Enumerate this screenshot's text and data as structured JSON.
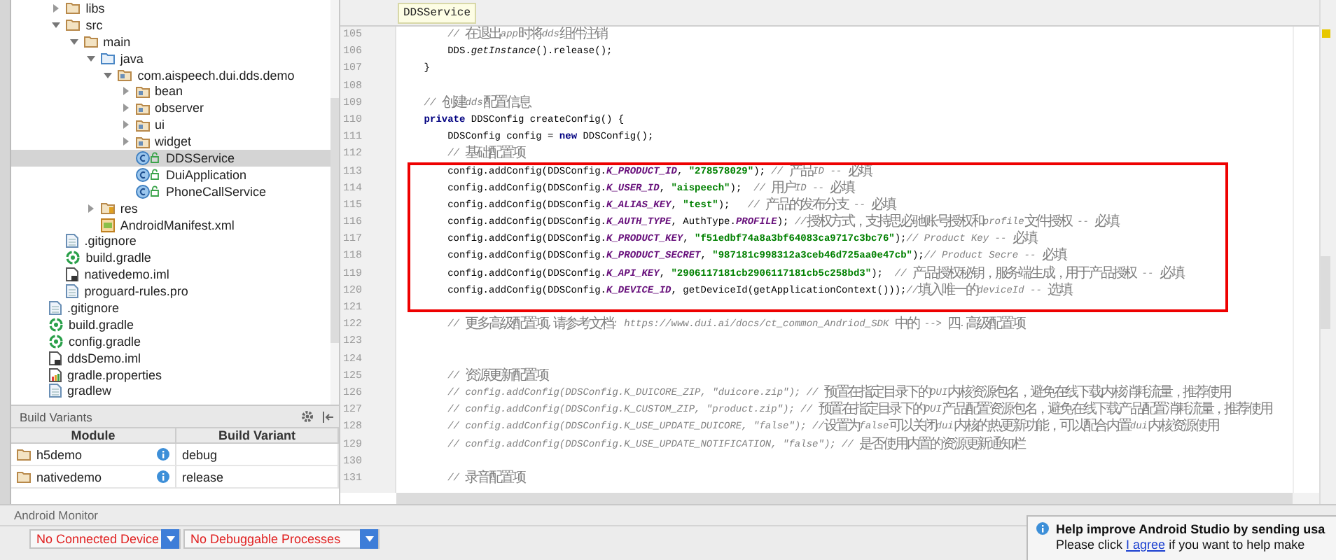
{
  "project_tree": [
    {
      "children": [
        {
          "label": "libs",
          "kind": "folder",
          "expanded": false,
          "selected": false
        },
        {
          "label": "src",
          "kind": "folder",
          "expanded": true,
          "selected": false,
          "children": [
            {
              "label": "main",
              "kind": "folder",
              "expanded": true,
              "selected": false,
              "children": [
                {
                  "label": "java",
                  "kind": "source-folder",
                  "expanded": true,
                  "selected": false,
                  "children": [
                    {
                      "label": "com.aispeech.dui.dds.demo",
                      "kind": "package",
                      "expanded": true,
                      "selected": false,
                      "children": [
                        {
                          "label": "bean",
                          "kind": "package",
                          "expanded": false,
                          "selected": false
                        },
                        {
                          "label": "observer",
                          "kind": "package",
                          "expanded": false,
                          "selected": false
                        },
                        {
                          "label": "ui",
                          "kind": "package",
                          "expanded": false,
                          "selected": false
                        },
                        {
                          "label": "widget",
                          "kind": "package",
                          "expanded": false,
                          "selected": false
                        },
                        {
                          "label": "DDSService",
                          "kind": "class",
                          "selected": true
                        },
                        {
                          "label": "DuiApplication",
                          "kind": "class",
                          "selected": false
                        },
                        {
                          "label": "PhoneCallService",
                          "kind": "class",
                          "selected": false
                        }
                      ]
                    }
                  ]
                },
                {
                  "label": "res",
                  "kind": "resources",
                  "expanded": false,
                  "selected": false
                },
                {
                  "label": "AndroidManifest.xml",
                  "kind": "manifest",
                  "selected": false
                }
              ]
            }
          ]
        },
        {
          "label": ".gitignore",
          "kind": "file",
          "selected": false
        },
        {
          "label": "build.gradle",
          "kind": "gradle",
          "selected": false
        },
        {
          "label": "nativedemo.iml",
          "kind": "iml",
          "selected": false
        },
        {
          "label": "proguard-rules.pro",
          "kind": "file",
          "selected": false
        }
      ]
    },
    {
      "label": ".gitignore",
      "kind": "file",
      "selected": false
    },
    {
      "label": "build.gradle",
      "kind": "gradle",
      "selected": false
    },
    {
      "label": "config.gradle",
      "kind": "gradle",
      "selected": false
    },
    {
      "label": "ddsDemo.iml",
      "kind": "iml",
      "selected": false
    },
    {
      "label": "gradle.properties",
      "kind": "properties",
      "selected": false
    },
    {
      "label": "gradlew",
      "kind": "file",
      "selected": false
    }
  ],
  "build_variants": {
    "title": "Build Variants",
    "columns": [
      "Module",
      "Build Variant"
    ],
    "rows": [
      {
        "module": "h5demo",
        "variant": "debug"
      },
      {
        "module": "nativedemo",
        "variant": "release"
      }
    ]
  },
  "editor": {
    "tab": "DDSService",
    "lines": [
      {
        "number": "105",
        "kind": "statement",
        "tokens": [
          {
            "kind": "comment",
            "text": "// 在退出app时将dds组件注销"
          }
        ]
      },
      {
        "number": "106",
        "kind": "statement",
        "tokens": [
          {
            "kind": "plain",
            "text": "DDS."
          },
          {
            "kind": "method",
            "text": "getInstance"
          },
          {
            "kind": "plain",
            "text": "().release();"
          }
        ]
      },
      {
        "number": "107",
        "kind": "member",
        "tokens": [
          {
            "kind": "plain",
            "text": "}"
          }
        ]
      },
      {
        "number": "108"
      },
      {
        "number": "109",
        "kind": "member",
        "tokens": [
          {
            "kind": "comment",
            "text": "// 创建dds配置信息"
          }
        ]
      },
      {
        "number": "110",
        "kind": "member",
        "tokens": [
          {
            "kind": "keyword",
            "text": "private"
          },
          {
            "kind": "plain",
            "text": " DDSConfig createConfig() {"
          }
        ]
      },
      {
        "number": "111",
        "kind": "statement",
        "tokens": [
          {
            "kind": "plain",
            "text": "DDSConfig config = "
          },
          {
            "kind": "keyword",
            "text": "new"
          },
          {
            "kind": "plain",
            "text": " DDSConfig();"
          }
        ]
      },
      {
        "number": "112",
        "kind": "statement",
        "tokens": [
          {
            "kind": "comment",
            "text": "// 基础配置项"
          }
        ]
      },
      {
        "number": "113",
        "kind": "statement",
        "tokens": [
          {
            "kind": "plain",
            "text": "config.addConfig(DDSConfig."
          },
          {
            "kind": "constant",
            "text": "K_PRODUCT_ID"
          },
          {
            "kind": "plain",
            "text": ", "
          },
          {
            "kind": "string",
            "text": "\"278578029\""
          },
          {
            "kind": "plain",
            "text": "); "
          },
          {
            "kind": "comment",
            "text": "// 产品ID -- 必填"
          }
        ]
      },
      {
        "number": "114",
        "kind": "statement",
        "tokens": [
          {
            "kind": "plain",
            "text": "config.addConfig(DDSConfig."
          },
          {
            "kind": "constant",
            "text": "K_USER_ID"
          },
          {
            "kind": "plain",
            "text": ", "
          },
          {
            "kind": "string",
            "text": "\"aispeech\""
          },
          {
            "kind": "plain",
            "text": ");  "
          },
          {
            "kind": "comment",
            "text": "// 用户ID -- 必填"
          }
        ]
      },
      {
        "number": "115",
        "kind": "statement",
        "tokens": [
          {
            "kind": "plain",
            "text": "config.addConfig(DDSConfig."
          },
          {
            "kind": "constant",
            "text": "K_ALIAS_KEY"
          },
          {
            "kind": "plain",
            "text": ", "
          },
          {
            "kind": "string",
            "text": "\"test\""
          },
          {
            "kind": "plain",
            "text": ");   "
          },
          {
            "kind": "comment",
            "text": "// 产品的发布分支 -- 必填"
          }
        ]
      },
      {
        "number": "116",
        "kind": "statement",
        "tokens": [
          {
            "kind": "plain",
            "text": "config.addConfig(DDSConfig."
          },
          {
            "kind": "constant",
            "text": "K_AUTH_TYPE"
          },
          {
            "kind": "plain",
            "text": ", AuthType."
          },
          {
            "kind": "constant",
            "text": "PROFILE"
          },
          {
            "kind": "plain",
            "text": "); "
          },
          {
            "kind": "comment",
            "text": "//授权方式，支持思必驰账号授权和profile文件授权 -- 必填"
          }
        ]
      },
      {
        "number": "117",
        "kind": "statement",
        "tokens": [
          {
            "kind": "plain",
            "text": "config.addConfig(DDSConfig."
          },
          {
            "kind": "constant",
            "text": "K_PRODUCT_KEY"
          },
          {
            "kind": "plain",
            "text": ", "
          },
          {
            "kind": "string",
            "text": "\"f51edbf74a8a3bf64083ca9717c3bc76\""
          },
          {
            "kind": "plain",
            "text": ");"
          },
          {
            "kind": "comment",
            "text": "// Product Key -- 必填"
          }
        ]
      },
      {
        "number": "118",
        "kind": "statement",
        "tokens": [
          {
            "kind": "plain",
            "text": "config.addConfig(DDSConfig."
          },
          {
            "kind": "constant",
            "text": "K_PRODUCT_SECRET"
          },
          {
            "kind": "plain",
            "text": ", "
          },
          {
            "kind": "string",
            "text": "\"987181c998312a3ceb46d725aa0e47cb\""
          },
          {
            "kind": "plain",
            "text": ");"
          },
          {
            "kind": "comment",
            "text": "// Product Secre -- 必填"
          }
        ]
      },
      {
        "number": "119",
        "kind": "statement",
        "tokens": [
          {
            "kind": "plain",
            "text": "config.addConfig(DDSConfig."
          },
          {
            "kind": "constant",
            "text": "K_API_KEY"
          },
          {
            "kind": "plain",
            "text": ", "
          },
          {
            "kind": "string",
            "text": "\"2906117181cb2906117181cb5c258bd3\""
          },
          {
            "kind": "plain",
            "text": ");  "
          },
          {
            "kind": "comment",
            "text": "// 产品授权秘钥，服务端生成，用于产品授权 -- 必填"
          }
        ]
      },
      {
        "number": "120",
        "kind": "statement",
        "tokens": [
          {
            "kind": "plain",
            "text": "config.addConfig(DDSConfig."
          },
          {
            "kind": "constant",
            "text": "K_DEVICE_ID"
          },
          {
            "kind": "plain",
            "text": ", getDeviceId(getApplicationContext()));"
          },
          {
            "kind": "comment",
            "text": "//填入唯一的deviceId -- 选填"
          }
        ]
      },
      {
        "number": "121"
      },
      {
        "number": "122",
        "kind": "statement",
        "tokens": [
          {
            "kind": "comment",
            "text": "// 更多高级配置项,请参考文档: https://www.dui.ai/docs/ct_common_Andriod_SDK 中的 --> 四.高级配置项"
          }
        ]
      },
      {
        "number": "123"
      },
      {
        "number": "124"
      },
      {
        "number": "125",
        "kind": "statement",
        "tokens": [
          {
            "kind": "comment",
            "text": "// 资源更新配置项"
          }
        ]
      },
      {
        "number": "126",
        "kind": "statement",
        "tokens": [
          {
            "kind": "comment",
            "text": "// config.addConfig(DDSConfig.K_DUICORE_ZIP, \"duicore.zip\"); // 预置在指定目录下的DUI内核资源包名，避免在线下载内核消耗流量，推荐使用"
          }
        ]
      },
      {
        "number": "127",
        "kind": "statement",
        "tokens": [
          {
            "kind": "comment",
            "text": "// config.addConfig(DDSConfig.K_CUSTOM_ZIP, \"product.zip\"); // 预置在指定目录下的DUI产品配置资源包名，避免在线下载产品配置消耗流量，推荐使用"
          }
        ]
      },
      {
        "number": "128",
        "kind": "statement",
        "tokens": [
          {
            "kind": "comment",
            "text": "// config.addConfig(DDSConfig.K_USE_UPDATE_DUICORE, \"false\"); //设置为false可以关闭dui内核的热更新功能，可以配合内置dui内核资源使用"
          }
        ]
      },
      {
        "number": "129",
        "kind": "statement",
        "tokens": [
          {
            "kind": "comment",
            "text": "// config.addConfig(DDSConfig.K_USE_UPDATE_NOTIFICATION, \"false\"); // 是否使用内置的资源更新通知栏"
          }
        ]
      },
      {
        "number": "130"
      },
      {
        "number": "131",
        "kind": "statement",
        "tokens": [
          {
            "kind": "comment",
            "text": "// 录音配置项"
          }
        ]
      }
    ]
  },
  "android_monitor": {
    "title": "Android Monitor",
    "device_dropdown": "No Connected Device",
    "process_dropdown": "No Debuggable Processes"
  },
  "notification": {
    "title": "Help improve Android Studio by sending usa",
    "message_before": "Please click ",
    "link": "I agree",
    "message_after": " if you want to help make"
  }
}
